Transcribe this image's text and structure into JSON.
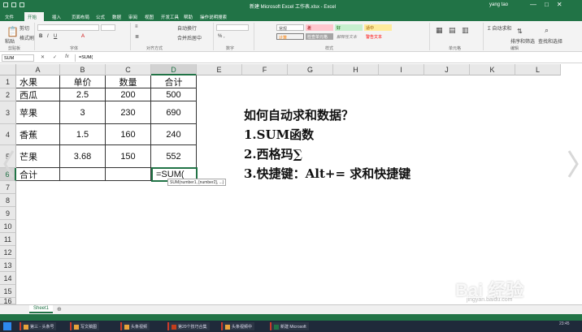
{
  "window": {
    "title": "新建 Microsoft Excel 工作表.xlsx - Excel",
    "user": "yang tao",
    "controls": [
      "—",
      "□",
      "✕"
    ]
  },
  "ribbon_tabs": [
    "文件",
    "开始",
    "插入",
    "页面布局",
    "公式",
    "数据",
    "审阅",
    "视图",
    "开发工具",
    "帮助",
    "操作说明搜索"
  ],
  "ribbon": {
    "groups": [
      "剪贴板",
      "字体",
      "对齐方式",
      "数字",
      "样式",
      "单元格",
      "编辑"
    ],
    "styles": [
      "常规",
      "差",
      "好",
      "适中",
      "计算",
      "检查单元格",
      "解释性文本",
      "警告文本"
    ],
    "buttons": {
      "cut": "剪切",
      "paste": "粘贴",
      "format_painter": "格式刷",
      "wrap": "自动换行",
      "merge": "合并后居中",
      "sum": "Σ 自动求和",
      "sort": "排序和筛选",
      "find": "查找和选择"
    }
  },
  "formula_bar": {
    "name_box": "SUM",
    "buttons": [
      "✕",
      "✓",
      "fx"
    ],
    "formula": "=SUM("
  },
  "columns": [
    "A",
    "B",
    "C",
    "D",
    "E",
    "F",
    "G",
    "H",
    "I",
    "J",
    "K",
    "L"
  ],
  "rows": [
    "1",
    "2",
    "3",
    "4",
    "5",
    "6",
    "7",
    "8",
    "9",
    "10",
    "11",
    "12",
    "13",
    "14",
    "15",
    "16"
  ],
  "table": {
    "header": [
      "水果",
      "单价",
      "数量",
      "合计"
    ],
    "rows": [
      [
        "西瓜",
        "2.5",
        "200",
        "500"
      ],
      [
        "苹果",
        "3",
        "230",
        "690"
      ],
      [
        "香蕉",
        "1.5",
        "160",
        "240"
      ],
      [
        "芒果",
        "3.68",
        "150",
        "552"
      ],
      [
        "合计",
        "",
        "",
        "=SUM("
      ]
    ]
  },
  "tooltip": "SUM(number1, [number2], ...)",
  "notes": [
    "如何自动求和数据？",
    "1.SUM函数",
    "2.西格玛∑",
    "3.快捷键：Alt+= 求和快捷键"
  ],
  "sheets": [
    "Sheet1"
  ],
  "taskbar": {
    "items": [
      "第三 - 头条号",
      "写文稿图",
      "头条视频",
      "第20个技巧合集",
      "头条视频中",
      "新建 Microsoft"
    ],
    "clock": "23:45"
  },
  "watermark": "Bai 经验",
  "watermark_sub": "jingyan.baidu.com",
  "colors": {
    "excel_green": "#217346",
    "selection": "#217346"
  }
}
